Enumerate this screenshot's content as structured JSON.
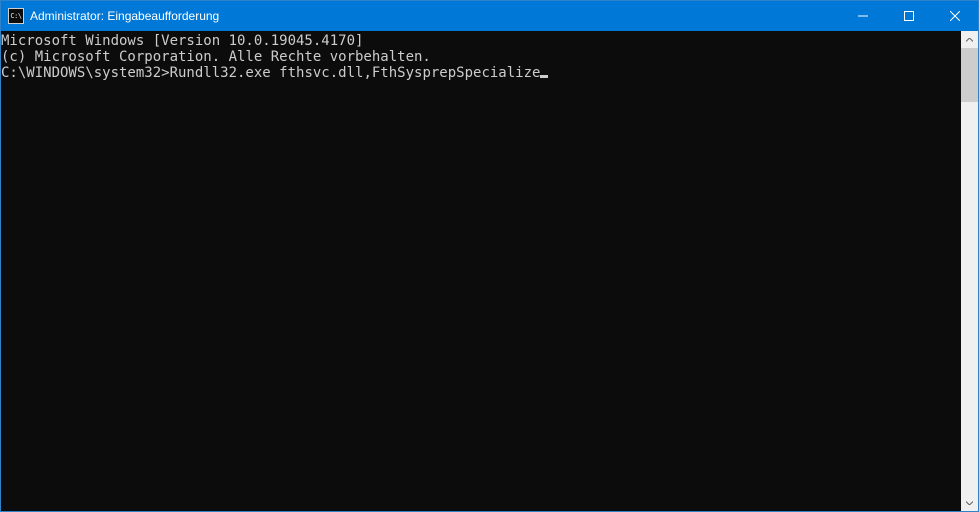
{
  "window": {
    "title": "Administrator: Eingabeaufforderung",
    "icon_label": "C:\\"
  },
  "terminal": {
    "line1": "Microsoft Windows [Version 10.0.19045.4170]",
    "line2": "(c) Microsoft Corporation. Alle Rechte vorbehalten.",
    "blank": "",
    "prompt_path": "C:\\WINDOWS\\system32>",
    "command": "Rundll32.exe fthsvc.dll,FthSysprepSpecialize"
  },
  "scrollbar": {
    "thumb_top_pct": 0,
    "thumb_height_pct": 12
  }
}
